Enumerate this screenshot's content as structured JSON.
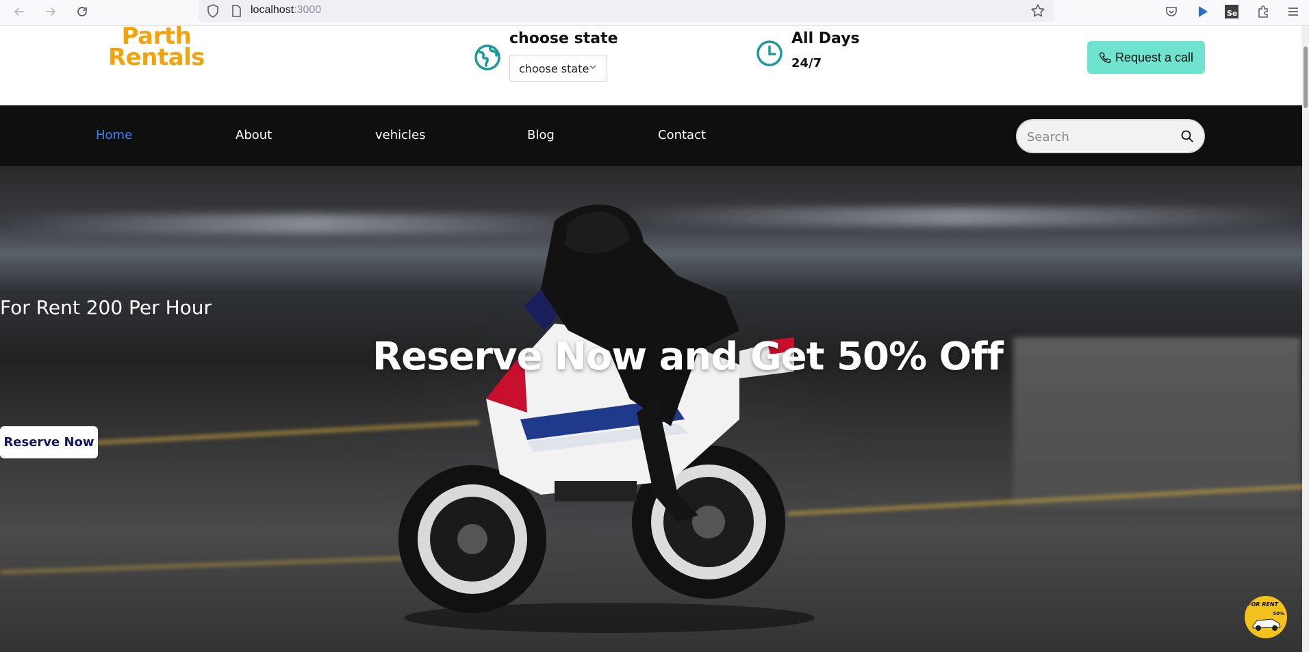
{
  "browser": {
    "url_host": "localhost",
    "url_port": ":3000"
  },
  "header": {
    "logo_line1": "Parth",
    "logo_line2": "Rentals",
    "state_title": "choose state",
    "state_select_value": "choose state",
    "days_title": "All Days",
    "days_sub": "24/7",
    "call_button": "Request a call"
  },
  "nav": {
    "items": [
      {
        "label": "Home",
        "active": true
      },
      {
        "label": "About"
      },
      {
        "label": "vehicles"
      },
      {
        "label": "Blog"
      },
      {
        "label": "Contact"
      }
    ],
    "search_placeholder": "Search"
  },
  "hero": {
    "small_text": "For Rent 200 Per Hour",
    "title": "Reserve Now and Get 50% Off",
    "reserve_button": "Reserve Now",
    "promo_text": "FOR RENT",
    "promo_off": "50%"
  },
  "colors": {
    "logo": "#f5a30c",
    "accent_teal": "#6ee3cf",
    "icon_teal": "#1a9aa0",
    "nav_active": "#3b82f6",
    "nav_bg": "#0f0f0f",
    "reserve_text": "#0d1660"
  }
}
